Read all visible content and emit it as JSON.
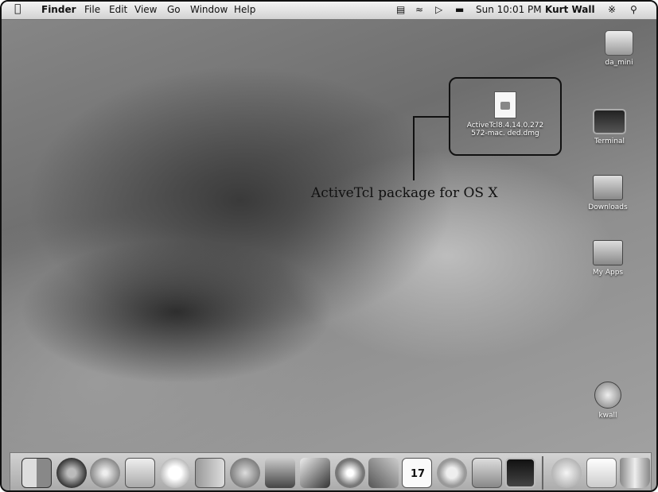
{
  "menubar": {
    "app_name": "Finder",
    "menus": [
      "File",
      "Edit",
      "View",
      "Go",
      "Window",
      "Help"
    ],
    "clock": "Sun 10:01 PM",
    "user": "Kurt Wall"
  },
  "desktop_icons": {
    "drive": "da_mini",
    "terminal": "Terminal",
    "downloads": "Downloads",
    "my_apps": "My Apps",
    "home": "kwall"
  },
  "dmg_file": {
    "line1": "ActiveTcl8.4.14.0.272",
    "line2": "572-mac.  ded.dmg"
  },
  "callout": "ActiveTcl package for OS X",
  "dock": {
    "calendar_day": "17",
    "items": [
      "finder-icon",
      "dashboard-icon",
      "safari-icon",
      "preview-icon",
      "ichat-icon",
      "address-book-icon",
      "itunes-icon",
      "iphoto-icon",
      "imovie-icon",
      "idvd-icon",
      "garageband-icon",
      "ical-icon",
      "time-sync-icon",
      "system-preferences-icon",
      "terminal-icon",
      "mail-icon",
      "documents-icon",
      "trash-icon"
    ]
  }
}
